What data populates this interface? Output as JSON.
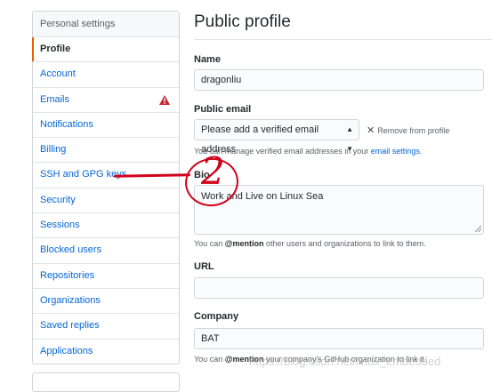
{
  "sidebar": {
    "header": "Personal settings",
    "items": [
      {
        "label": "Profile",
        "active": true
      },
      {
        "label": "Account"
      },
      {
        "label": "Emails",
        "warning": true
      },
      {
        "label": "Notifications"
      },
      {
        "label": "Billing"
      },
      {
        "label": "SSH and GPG keys"
      },
      {
        "label": "Security"
      },
      {
        "label": "Sessions"
      },
      {
        "label": "Blocked users"
      },
      {
        "label": "Repositories"
      },
      {
        "label": "Organizations"
      },
      {
        "label": "Saved replies"
      },
      {
        "label": "Applications"
      }
    ]
  },
  "main": {
    "title": "Public profile",
    "name": {
      "label": "Name",
      "value": "dragonliu"
    },
    "public_email": {
      "label": "Public email",
      "selected": "Please add a verified email address",
      "remove_label": "Remove from profile",
      "note_prefix": "You can manage verified email addresses in your ",
      "note_link": "email settings",
      "note_suffix": "."
    },
    "bio": {
      "label": "Bio",
      "value": "Work and Live on Linux Sea",
      "note_prefix": "You can ",
      "note_mention": "@mention",
      "note_suffix": " other users and organizations to link to them."
    },
    "url": {
      "label": "URL",
      "value": ""
    },
    "company": {
      "label": "Company",
      "value": "BAT",
      "note_prefix": "You can ",
      "note_mention": "@mention",
      "note_suffix": " your company's GitHub organization to link it."
    }
  },
  "annotation": {
    "number": "2",
    "color": "#d0021b"
  },
  "watermark": "https://blog.csdn.net/linux_embedded",
  "colors": {
    "link": "#0366d6",
    "active_marker": "#e36209",
    "warning": "#cb2431"
  }
}
